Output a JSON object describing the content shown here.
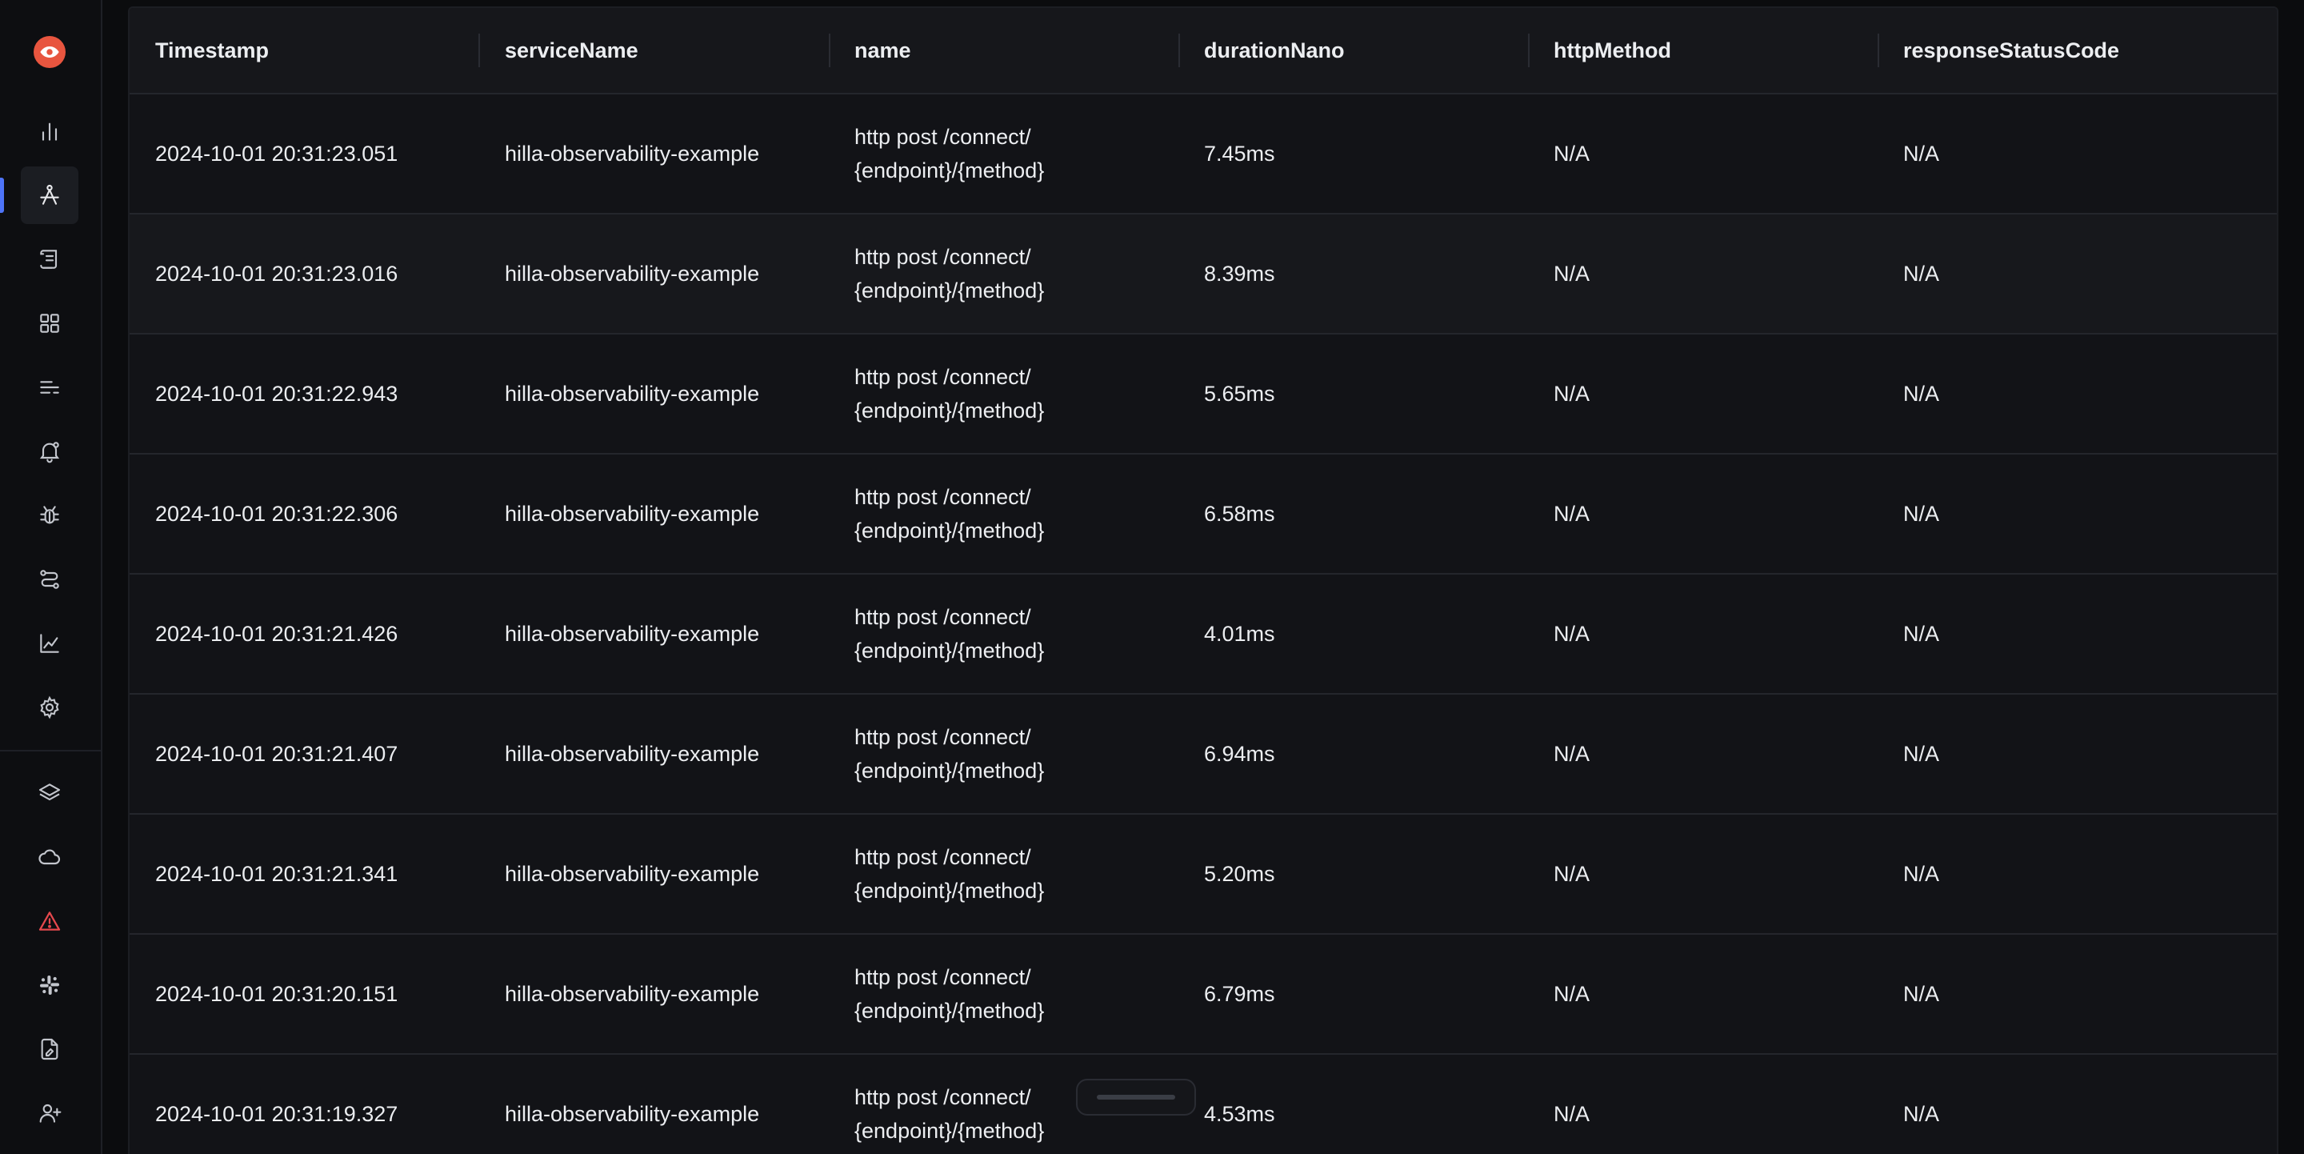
{
  "colors": {
    "accent": "#4e74f8",
    "brand": "#e8553f",
    "alert": "#e5484d",
    "icon": "#c3c6cd",
    "background": "#0b0c0e"
  },
  "sidebar": {
    "items": [
      {
        "name": "bar-chart-icon"
      },
      {
        "name": "trace-explorer-icon",
        "active": true
      },
      {
        "name": "logs-scroll-icon"
      },
      {
        "name": "dashboard-grid-icon"
      },
      {
        "name": "list-lines-icon"
      },
      {
        "name": "alert-bell-icon"
      },
      {
        "name": "bug-icon"
      },
      {
        "name": "pipelines-route-icon"
      },
      {
        "name": "line-chart-icon"
      },
      {
        "name": "gear-icon"
      }
    ],
    "bottom_items": [
      {
        "name": "layers-icon"
      },
      {
        "name": "cloud-icon"
      },
      {
        "name": "warning-triangle-icon"
      },
      {
        "name": "slack-icon"
      },
      {
        "name": "document-edit-icon"
      },
      {
        "name": "add-user-icon"
      }
    ]
  },
  "table": {
    "columns": [
      "Timestamp",
      "serviceName",
      "name",
      "durationNano",
      "httpMethod",
      "responseStatusCode"
    ],
    "rows": [
      {
        "timestamp": "2024-10-01 20:31:23.051",
        "service": "hilla-observability-example",
        "name_line1": "http post /connect/",
        "name_line2": "{endpoint}/{method}",
        "duration": "7.45ms",
        "method": "N/A",
        "status": "N/A"
      },
      {
        "timestamp": "2024-10-01 20:31:23.016",
        "service": "hilla-observability-example",
        "name_line1": "http post /connect/",
        "name_line2": "{endpoint}/{method}",
        "duration": "8.39ms",
        "method": "N/A",
        "status": "N/A"
      },
      {
        "timestamp": "2024-10-01 20:31:22.943",
        "service": "hilla-observability-example",
        "name_line1": "http post /connect/",
        "name_line2": "{endpoint}/{method}",
        "duration": "5.65ms",
        "method": "N/A",
        "status": "N/A"
      },
      {
        "timestamp": "2024-10-01 20:31:22.306",
        "service": "hilla-observability-example",
        "name_line1": "http post /connect/",
        "name_line2": "{endpoint}/{method}",
        "duration": "6.58ms",
        "method": "N/A",
        "status": "N/A"
      },
      {
        "timestamp": "2024-10-01 20:31:21.426",
        "service": "hilla-observability-example",
        "name_line1": "http post /connect/",
        "name_line2": "{endpoint}/{method}",
        "duration": "4.01ms",
        "method": "N/A",
        "status": "N/A"
      },
      {
        "timestamp": "2024-10-01 20:31:21.407",
        "service": "hilla-observability-example",
        "name_line1": "http post /connect/",
        "name_line2": "{endpoint}/{method}",
        "duration": "6.94ms",
        "method": "N/A",
        "status": "N/A"
      },
      {
        "timestamp": "2024-10-01 20:31:21.341",
        "service": "hilla-observability-example",
        "name_line1": "http post /connect/",
        "name_line2": "{endpoint}/{method}",
        "duration": "5.20ms",
        "method": "N/A",
        "status": "N/A"
      },
      {
        "timestamp": "2024-10-01 20:31:20.151",
        "service": "hilla-observability-example",
        "name_line1": "http post /connect/",
        "name_line2": "{endpoint}/{method}",
        "duration": "6.79ms",
        "method": "N/A",
        "status": "N/A"
      },
      {
        "timestamp": "2024-10-01 20:31:19.327",
        "service": "hilla-observability-example",
        "name_line1": "http post /connect/",
        "name_line2": "{endpoint}/{method}",
        "duration": "4.53ms",
        "method": "N/A",
        "status": "N/A"
      }
    ]
  }
}
